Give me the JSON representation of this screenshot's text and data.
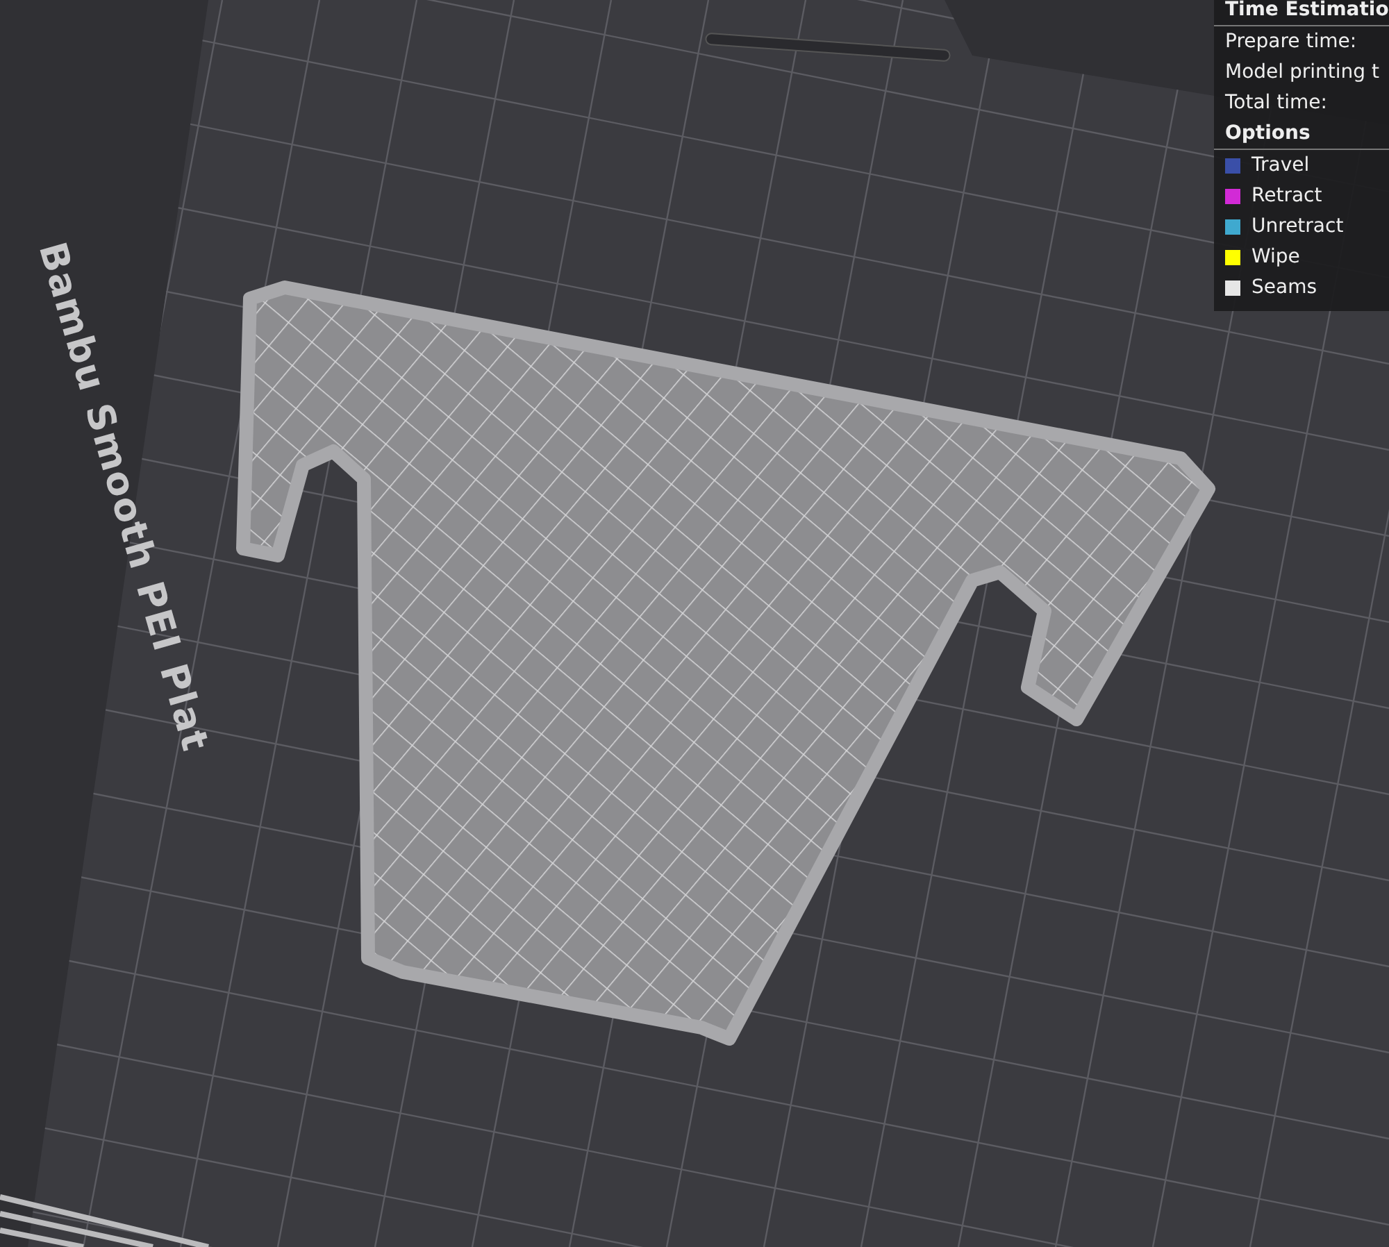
{
  "plate_label": "Bambu Smooth PEI Plat",
  "time_estimation": {
    "title": "Time Estimatio",
    "rows": [
      {
        "label": "Prepare time:"
      },
      {
        "label": "Model printing t"
      },
      {
        "label": "Total time:"
      }
    ]
  },
  "options": {
    "title": "Options",
    "items": [
      {
        "label": "Travel",
        "color": "#3a4fa8"
      },
      {
        "label": "Retract",
        "color": "#d22ad6"
      },
      {
        "label": "Unretract",
        "color": "#3fa9cf"
      },
      {
        "label": "Wipe",
        "color": "#ffff00"
      },
      {
        "label": "Seams",
        "color": "#e6e6e6"
      }
    ]
  }
}
